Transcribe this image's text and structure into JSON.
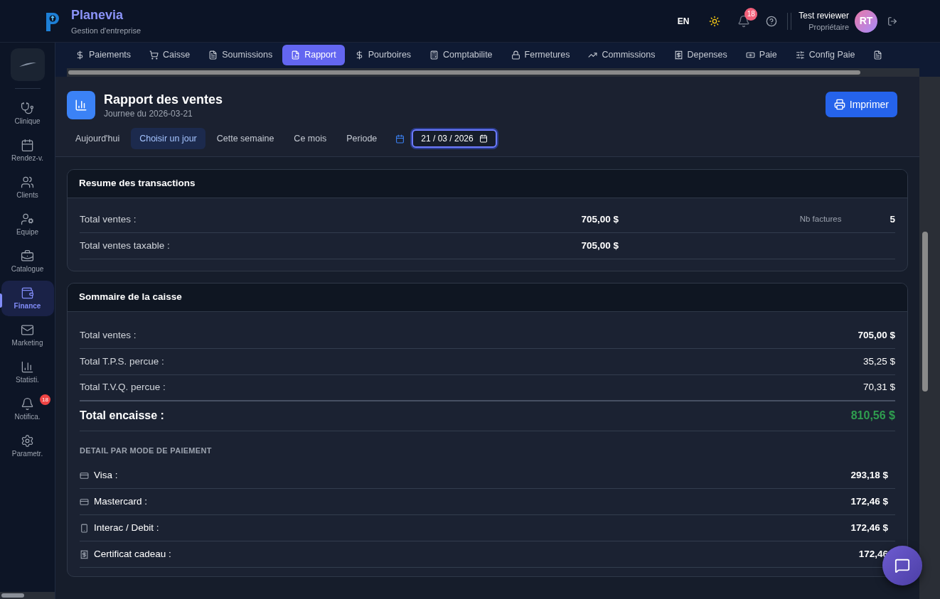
{
  "header": {
    "app_name": "Planevia",
    "tagline": "Gestion d'entreprise",
    "language": "EN",
    "notifications_badge": "18",
    "user": {
      "name": "Test reviewer",
      "role": "Propriétaire",
      "initials": "RT"
    }
  },
  "sidebar": {
    "items": [
      {
        "label": "Clinique",
        "selected": false
      },
      {
        "label": "Rendez-v.",
        "selected": false
      },
      {
        "label": "Clients",
        "selected": false
      },
      {
        "label": "Equipe",
        "selected": false
      },
      {
        "label": "Catalogue",
        "selected": false
      },
      {
        "label": "Finance",
        "selected": true
      },
      {
        "label": "Marketing",
        "selected": false
      },
      {
        "label": "Statisti.",
        "selected": false
      },
      {
        "label": "Notifica.",
        "selected": false,
        "badge": "18"
      },
      {
        "label": "Parametr.",
        "selected": false
      }
    ]
  },
  "tabs": [
    {
      "label": "Paiements",
      "selected": false
    },
    {
      "label": "Caisse",
      "selected": false
    },
    {
      "label": "Soumissions",
      "selected": false
    },
    {
      "label": "Rapport",
      "selected": true
    },
    {
      "label": "Pourboires",
      "selected": false
    },
    {
      "label": "Comptabilite",
      "selected": false
    },
    {
      "label": "Fermetures",
      "selected": false
    },
    {
      "label": "Commissions",
      "selected": false
    },
    {
      "label": "Depenses",
      "selected": false
    },
    {
      "label": "Paie",
      "selected": false
    },
    {
      "label": "Config Paie",
      "selected": false
    },
    {
      "selected": false
    }
  ],
  "report": {
    "title": "Rapport des ventes",
    "subtitle": "Journee du 2026-03-21",
    "print_button": "Imprimer",
    "filters": [
      {
        "label": "Aujourd'hui",
        "selected": false
      },
      {
        "label": "Choisir un jour",
        "selected": true
      },
      {
        "label": "Cette semaine",
        "selected": false
      },
      {
        "label": "Ce mois",
        "selected": false
      },
      {
        "label": "Periode",
        "selected": false
      }
    ],
    "date_value": "21 / 03 / 2026"
  },
  "transactions": {
    "title": "Resume des transactions",
    "rows": [
      {
        "label": "Total ventes :",
        "value": "705,00 $",
        "count_label": "Nb factures",
        "count": "5"
      },
      {
        "label": "Total ventes taxable :",
        "value": "705,00 $"
      }
    ]
  },
  "cash": {
    "title": "Sommaire de la caisse",
    "rows": [
      {
        "label": "Total ventes :",
        "value": "705,00 $",
        "bold": true
      },
      {
        "label": "Total T.P.S. percue :",
        "value": "35,25 $",
        "bold": false
      },
      {
        "label": "Total T.V.Q. percue :",
        "value": "70,31 $",
        "bold": false
      }
    ],
    "total": {
      "label": "Total encaisse :",
      "value": "810,56 $"
    },
    "detail_title": "DETAIL PAR MODE DE PAIEMENT",
    "payments": [
      {
        "label": "Visa :",
        "value": "293,18 $"
      },
      {
        "label": "Mastercard :",
        "value": "172,46 $"
      },
      {
        "label": "Interac / Debit :",
        "value": "172,46 $"
      },
      {
        "label": "Certificat cadeau :",
        "value": "172,46"
      }
    ]
  }
}
